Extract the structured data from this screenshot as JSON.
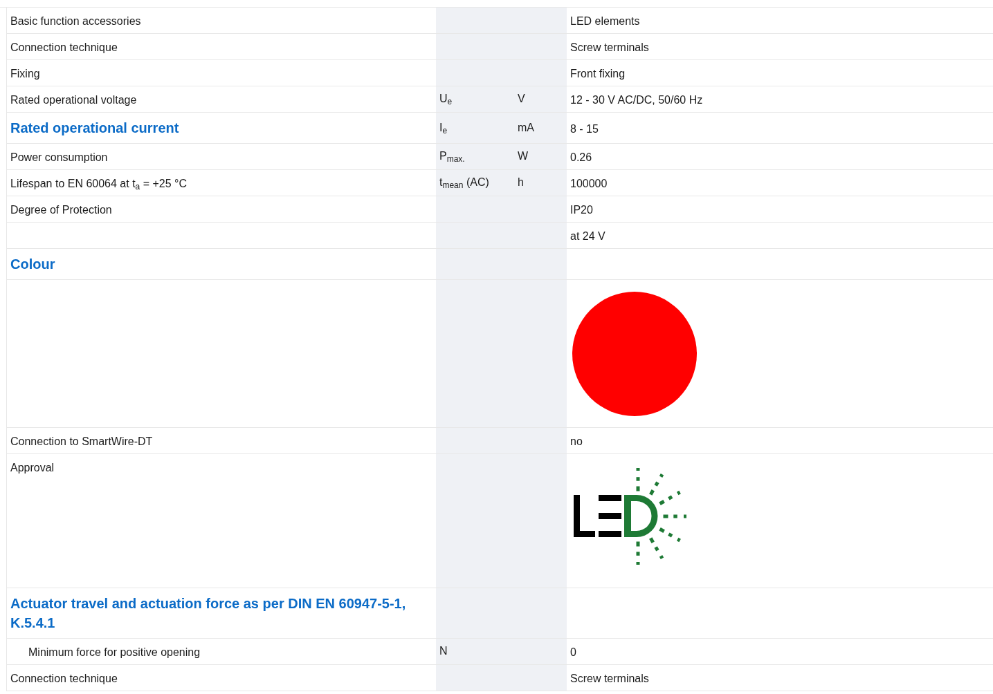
{
  "rows": [
    {
      "kind": "row",
      "label": "Basic function accessories",
      "value": "LED elements"
    },
    {
      "kind": "row",
      "label": "Connection technique",
      "value": "Screw terminals"
    },
    {
      "kind": "row",
      "label": "Fixing",
      "value": "Front fixing"
    },
    {
      "kind": "row",
      "label": "Rated operational voltage",
      "symbol": "U$_{e}$",
      "unit": "V",
      "value": "12 - 30 V AC/DC, 50/60 Hz"
    },
    {
      "kind": "heading",
      "label": "Rated operational current",
      "symbol": "I$_{e}$",
      "unit": "mA",
      "value": "8 - 15"
    },
    {
      "kind": "row",
      "label": "Power consumption",
      "symbol": "P$_{max.}$",
      "unit": "W",
      "value": "0.26"
    },
    {
      "kind": "row",
      "label": "Lifespan to EN 60064 at t$_{a}$ = +25 °C",
      "symbol": "t$_{mean}$ (AC)",
      "unit": "h",
      "value": "100000"
    },
    {
      "kind": "row",
      "label": "Degree of Protection",
      "value": "IP20"
    },
    {
      "kind": "row",
      "value": "at 24 V"
    },
    {
      "kind": "heading",
      "label": "Colour"
    },
    {
      "kind": "swatch",
      "color": "#ff0000"
    },
    {
      "kind": "row",
      "label": "Connection to SmartWire-DT",
      "value": "no"
    },
    {
      "kind": "logo",
      "label": "Approval"
    },
    {
      "kind": "heading",
      "label": "Actuator travel and actuation force as per DIN EN 60947-5-1, K.5.4.1",
      "children": [
        {
          "kind": "row",
          "label": "Minimum force for positive opening",
          "symbol": "N",
          "value": "0"
        }
      ]
    },
    {
      "kind": "row",
      "label": "Connection technique",
      "value": "Screw terminals"
    }
  ]
}
